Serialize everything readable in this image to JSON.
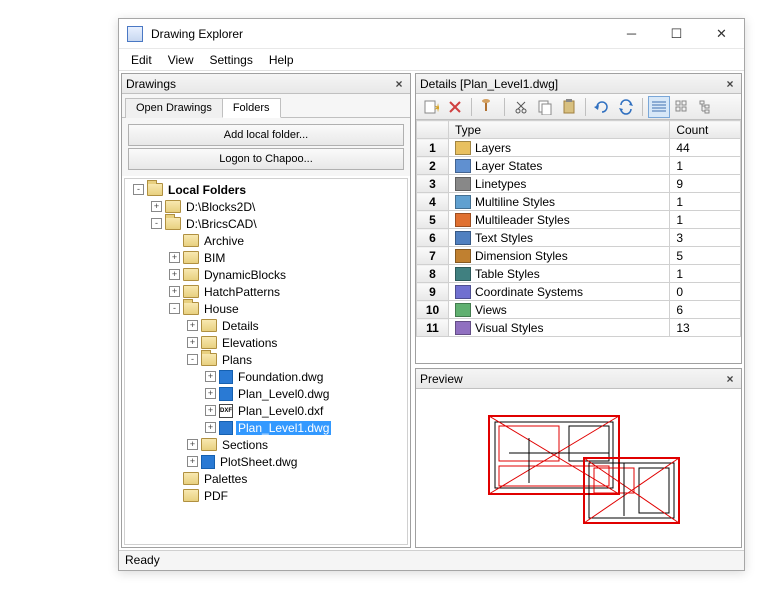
{
  "window": {
    "title": "Drawing Explorer"
  },
  "menubar": [
    "Edit",
    "View",
    "Settings",
    "Help"
  ],
  "leftPanel": {
    "title": "Drawings",
    "tabs": [
      "Open Drawings",
      "Folders"
    ],
    "activeTab": 1,
    "buttons": [
      "Add local folder...",
      "Logon to Chapoo..."
    ],
    "tree": [
      {
        "depth": 0,
        "exp": "-",
        "icon": "folder-open",
        "label": "Local Folders",
        "bold": true
      },
      {
        "depth": 1,
        "exp": "+",
        "icon": "folder-closed",
        "label": "D:\\Blocks2D\\"
      },
      {
        "depth": 1,
        "exp": "-",
        "icon": "folder-open",
        "label": "D:\\BricsCAD\\"
      },
      {
        "depth": 2,
        "exp": " ",
        "icon": "folder-closed",
        "label": "Archive"
      },
      {
        "depth": 2,
        "exp": "+",
        "icon": "folder-closed",
        "label": "BIM"
      },
      {
        "depth": 2,
        "exp": "+",
        "icon": "folder-closed",
        "label": "DynamicBlocks"
      },
      {
        "depth": 2,
        "exp": "+",
        "icon": "folder-closed",
        "label": "HatchPatterns"
      },
      {
        "depth": 2,
        "exp": "-",
        "icon": "folder-open",
        "label": "House"
      },
      {
        "depth": 3,
        "exp": "+",
        "icon": "folder-closed",
        "label": "Details"
      },
      {
        "depth": 3,
        "exp": "+",
        "icon": "folder-closed",
        "label": "Elevations"
      },
      {
        "depth": 3,
        "exp": "-",
        "icon": "folder-open",
        "label": "Plans"
      },
      {
        "depth": 4,
        "exp": "+",
        "icon": "dwg",
        "label": "Foundation.dwg"
      },
      {
        "depth": 4,
        "exp": "+",
        "icon": "dwg",
        "label": "Plan_Level0.dwg"
      },
      {
        "depth": 4,
        "exp": "+",
        "icon": "dxf",
        "label": "Plan_Level0.dxf"
      },
      {
        "depth": 4,
        "exp": "+",
        "icon": "dwg",
        "label": "Plan_Level1.dwg",
        "selected": true
      },
      {
        "depth": 3,
        "exp": "+",
        "icon": "folder-closed",
        "label": "Sections"
      },
      {
        "depth": 3,
        "exp": "+",
        "icon": "dwg",
        "label": "PlotSheet.dwg"
      },
      {
        "depth": 2,
        "exp": " ",
        "icon": "folder-closed",
        "label": "Palettes"
      },
      {
        "depth": 2,
        "exp": " ",
        "icon": "folder-closed",
        "label": "PDF"
      }
    ]
  },
  "detailsPanel": {
    "title": "Details [Plan_Level1.dwg]",
    "columns": [
      "",
      "Type",
      "Count"
    ],
    "rows": [
      {
        "n": "1",
        "type": "Layers",
        "count": "44"
      },
      {
        "n": "2",
        "type": "Layer States",
        "count": "1"
      },
      {
        "n": "3",
        "type": "Linetypes",
        "count": "9"
      },
      {
        "n": "4",
        "type": "Multiline Styles",
        "count": "1"
      },
      {
        "n": "5",
        "type": "Multileader Styles",
        "count": "1"
      },
      {
        "n": "6",
        "type": "Text Styles",
        "count": "3"
      },
      {
        "n": "7",
        "type": "Dimension Styles",
        "count": "5"
      },
      {
        "n": "8",
        "type": "Table Styles",
        "count": "1"
      },
      {
        "n": "9",
        "type": "Coordinate Systems",
        "count": "0"
      },
      {
        "n": "10",
        "type": "Views",
        "count": "6"
      },
      {
        "n": "11",
        "type": "Visual Styles",
        "count": "13"
      }
    ]
  },
  "previewPanel": {
    "title": "Preview"
  },
  "statusbar": "Ready"
}
